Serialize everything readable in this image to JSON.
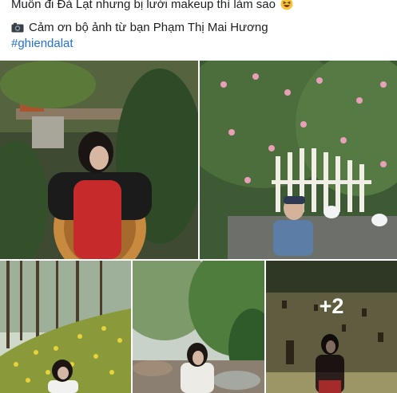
{
  "post": {
    "caption": "Muốn đi Đà Lạt nhưng bị lười makeup thì làm sao",
    "caption_emoji": "laughing-squinting-face-icon",
    "credit": "Cảm ơn bộ ảnh từ bạn Phạm Thị Mai Hương",
    "credit_icon": "camera-icon",
    "hashtag": "#ghiendalat"
  },
  "gallery": {
    "photos": [
      {
        "subject": "woman in red dress in wicker chair among plants"
      },
      {
        "subject": "person by white fence with pink roses"
      },
      {
        "subject": "person among yellow flowers in pine forest"
      },
      {
        "subject": "woman by stream in forest"
      },
      {
        "subject": "woman in field with tree stumps"
      }
    ],
    "more_count": "+2"
  },
  "colors": {
    "hashtag": "#216fdb",
    "text": "#1c1e21"
  }
}
